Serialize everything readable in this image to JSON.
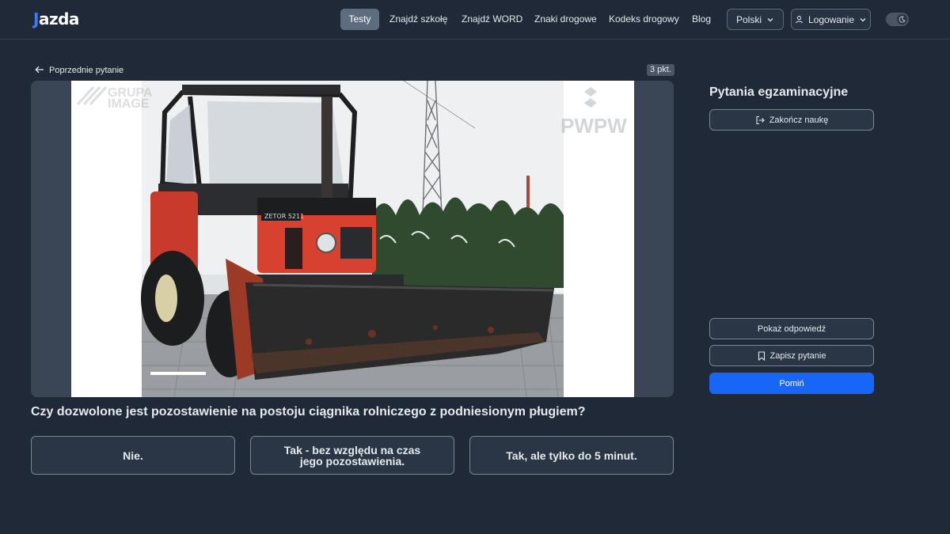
{
  "header": {
    "logo_j": "J",
    "logo_rest": "azda",
    "nav": {
      "tests": "Testy",
      "find_school": "Znajdź szkołę",
      "find_word": "Znajdź WORD",
      "road_signs": "Znaki drogowe",
      "road_code": "Kodeks drogowy",
      "blog": "Blog"
    },
    "language": "Polski",
    "login": "Logowanie"
  },
  "question_panel": {
    "previous_label": "Poprzednie pytanie",
    "points": "3 pkt.",
    "media": {
      "watermark_left": "GRUPA IMAGE",
      "watermark_right": "PWPW",
      "plate_text": "ZETOR 5211"
    },
    "question_text": "Czy dozwolone jest pozostawienie na postoju ciągnika rolniczego z podniesionym pługiem?",
    "answers": [
      "Nie.",
      "Tak - bez względu na czas jego pozostawienia.",
      "Tak, ale tylko do 5 minut."
    ]
  },
  "sidebar": {
    "title": "Pytania egzaminacyjne",
    "end_learning": "Zakończ naukę",
    "show_answer": "Pokaż odpowiedź",
    "save_question": "Zapisz pytanie",
    "skip": "Pomiń"
  },
  "colors": {
    "background": "#1f2938",
    "accent": "#1866f5",
    "logo_accent": "#3d7bf7",
    "tractor_red": "#d8412f"
  }
}
